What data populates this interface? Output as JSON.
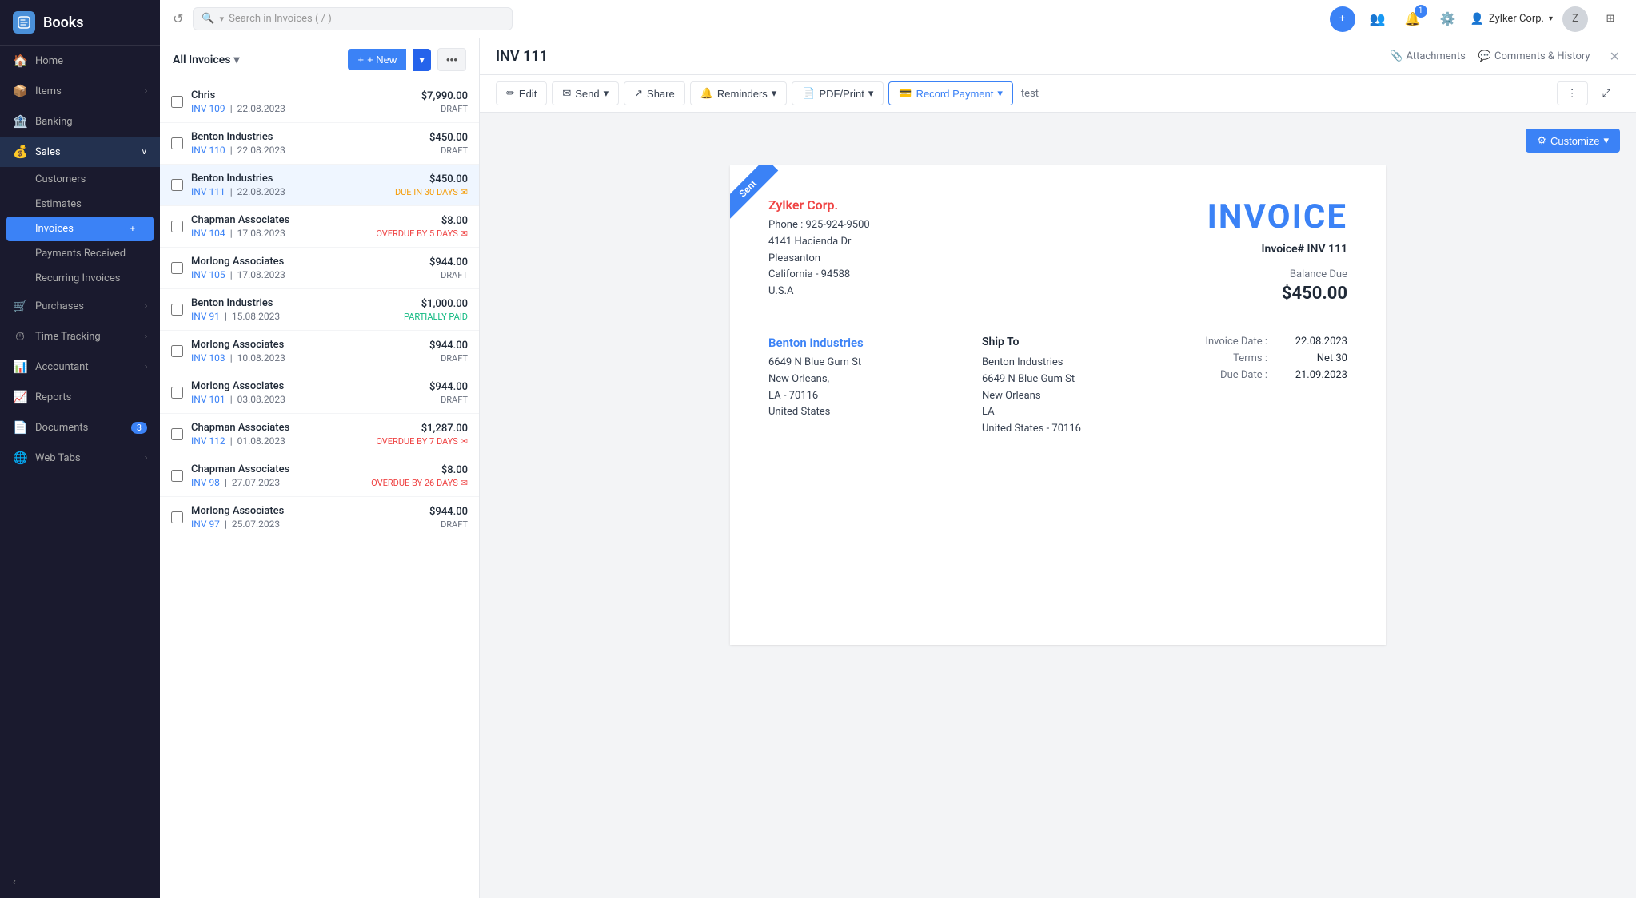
{
  "app": {
    "name": "Books",
    "logo_letter": "B"
  },
  "sidebar": {
    "nav_items": [
      {
        "id": "home",
        "label": "Home",
        "icon": "🏠",
        "has_arrow": false
      },
      {
        "id": "items",
        "label": "Items",
        "icon": "📦",
        "has_arrow": true
      },
      {
        "id": "banking",
        "label": "Banking",
        "icon": "🏦",
        "has_arrow": false
      },
      {
        "id": "sales",
        "label": "Sales",
        "icon": "💰",
        "has_arrow": true,
        "active": true
      }
    ],
    "sales_sub_items": [
      {
        "id": "customers",
        "label": "Customers",
        "active": false
      },
      {
        "id": "estimates",
        "label": "Estimates",
        "active": false
      },
      {
        "id": "invoices",
        "label": "Invoices",
        "active": true
      },
      {
        "id": "payments-received",
        "label": "Payments Received",
        "active": false
      },
      {
        "id": "recurring-invoices",
        "label": "Recurring Invoices",
        "active": false
      }
    ],
    "bottom_nav": [
      {
        "id": "purchases",
        "label": "Purchases",
        "icon": "🛒",
        "has_arrow": true
      },
      {
        "id": "time-tracking",
        "label": "Time Tracking",
        "icon": "⏱",
        "has_arrow": true
      },
      {
        "id": "accountant",
        "label": "Accountant",
        "icon": "📊",
        "has_arrow": true
      },
      {
        "id": "reports",
        "label": "Reports",
        "icon": "📈",
        "has_arrow": false
      },
      {
        "id": "documents",
        "label": "Documents",
        "icon": "📄",
        "has_arrow": false,
        "badge": "3"
      },
      {
        "id": "web-tabs",
        "label": "Web Tabs",
        "icon": "🌐",
        "has_arrow": true
      }
    ],
    "collapse_label": "‹"
  },
  "topbar": {
    "search_placeholder": "Search in Invoices ( / )",
    "add_tooltip": "+",
    "notifications_count": "1",
    "company_name": "Zylker Corp.",
    "user_avatar_initials": "Z"
  },
  "invoice_list": {
    "filter_label": "All Invoices",
    "new_button": "+ New",
    "invoices": [
      {
        "id": 1,
        "customer": "Chris",
        "inv_num": "INV 109",
        "date": "22.08.2023",
        "amount": "$7,990.00",
        "status": "DRAFT",
        "status_type": "draft"
      },
      {
        "id": 2,
        "customer": "Benton Industries",
        "inv_num": "INV 110",
        "date": "22.08.2023",
        "amount": "$450.00",
        "status": "DRAFT",
        "status_type": "draft"
      },
      {
        "id": 3,
        "customer": "Benton Industries",
        "inv_num": "INV 111",
        "date": "22.08.2023",
        "amount": "$450.00",
        "status": "DUE IN 30 DAYS",
        "status_type": "due",
        "selected": true
      },
      {
        "id": 4,
        "customer": "Chapman Associates",
        "inv_num": "INV 104",
        "date": "17.08.2023",
        "amount": "$8.00",
        "status": "OVERDUE BY 5 DAYS",
        "status_type": "overdue"
      },
      {
        "id": 5,
        "customer": "Morlong Associates",
        "inv_num": "INV 105",
        "date": "17.08.2023",
        "amount": "$944.00",
        "status": "DRAFT",
        "status_type": "draft"
      },
      {
        "id": 6,
        "customer": "Benton Industries",
        "inv_num": "INV 91",
        "date": "15.08.2023",
        "amount": "$1,000.00",
        "status": "PARTIALLY PAID",
        "status_type": "partial"
      },
      {
        "id": 7,
        "customer": "Morlong Associates",
        "inv_num": "INV 103",
        "date": "10.08.2023",
        "amount": "$944.00",
        "status": "DRAFT",
        "status_type": "draft"
      },
      {
        "id": 8,
        "customer": "Morlong Associates",
        "inv_num": "INV 101",
        "date": "03.08.2023",
        "amount": "$944.00",
        "status": "DRAFT",
        "status_type": "draft"
      },
      {
        "id": 9,
        "customer": "Chapman Associates",
        "inv_num": "INV 112",
        "date": "01.08.2023",
        "amount": "$1,287.00",
        "status": "OVERDUE BY 7 DAYS",
        "status_type": "overdue"
      },
      {
        "id": 10,
        "customer": "Chapman Associates",
        "inv_num": "INV 98",
        "date": "27.07.2023",
        "amount": "$8.00",
        "status": "OVERDUE BY 26 DAYS",
        "status_type": "overdue"
      },
      {
        "id": 11,
        "customer": "Morlong Associates",
        "inv_num": "INV 97",
        "date": "25.07.2023",
        "amount": "$944.00",
        "status": "DRAFT",
        "status_type": "draft"
      }
    ]
  },
  "invoice_detail": {
    "title": "INV 111",
    "attachments_label": "Attachments",
    "comments_label": "Comments & History",
    "toolbar": {
      "edit": "Edit",
      "send": "Send",
      "share": "Share",
      "reminders": "Reminders",
      "pdf_print": "PDF/Print",
      "record_payment": "Record Payment",
      "extra_label": "test"
    },
    "customize_btn": "Customize",
    "document": {
      "sent_ribbon": "Sent",
      "company": {
        "name": "Zylker Corp.",
        "phone": "Phone : 925-924-9500",
        "address1": "4141 Hacienda Dr",
        "address2": "Pleasanton",
        "address3": "California - 94588",
        "address4": "U.S.A"
      },
      "invoice_label": "INVOICE",
      "invoice_num": "Invoice# INV 111",
      "balance_due_label": "Balance Due",
      "balance_due_amount": "$450.00",
      "bill_to": {
        "client_name": "Benton Industries",
        "address1": "6649 N Blue Gum St",
        "address2": "New Orleans,",
        "address3": "LA - 70116",
        "address4": "United States"
      },
      "ship_to_label": "Ship To",
      "ship_to": {
        "name": "Benton Industries",
        "address1": "6649 N Blue Gum St",
        "address2": "New Orleans",
        "address3": "LA",
        "address4": "United States - 70116"
      },
      "meta": {
        "invoice_date_label": "Invoice Date :",
        "invoice_date": "22.08.2023",
        "terms_label": "Terms :",
        "terms": "Net 30",
        "due_date_label": "Due Date :",
        "due_date": "21.09.2023"
      }
    }
  }
}
